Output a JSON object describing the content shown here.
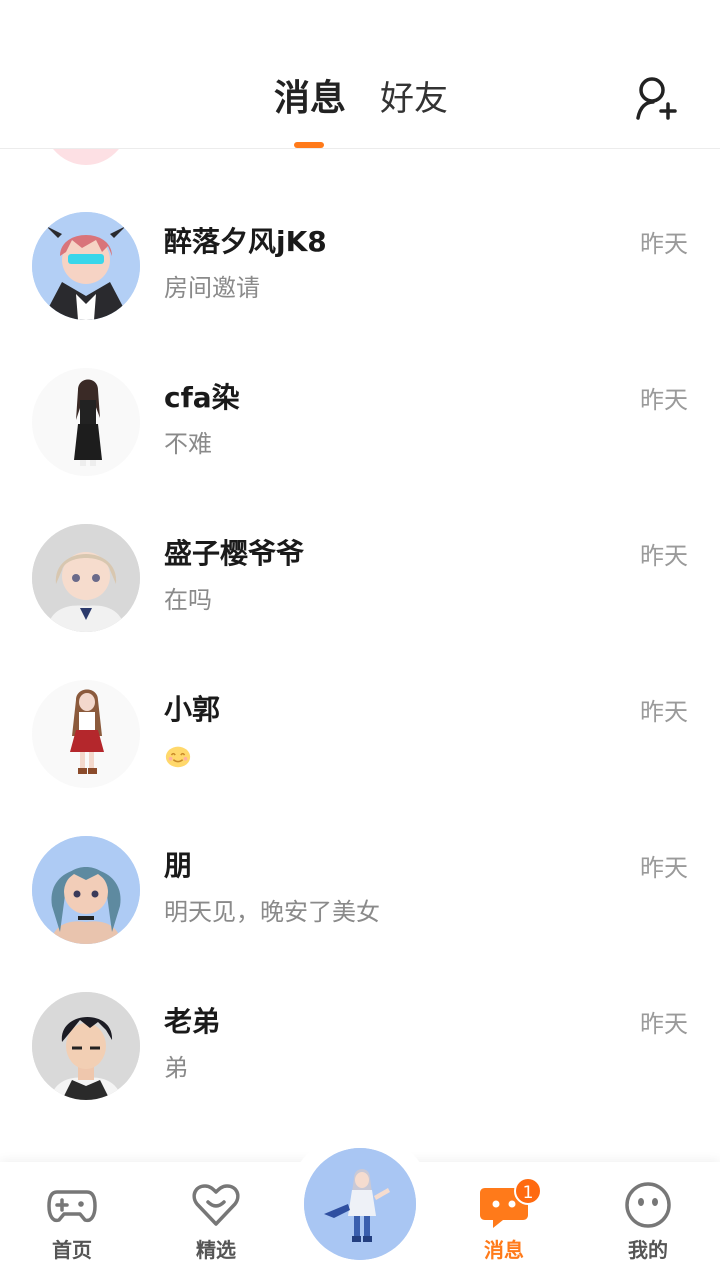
{
  "header": {
    "tabs": [
      {
        "label": "消息",
        "active": true
      },
      {
        "label": "好友",
        "active": false
      }
    ],
    "add_friend_icon": "add-user-icon",
    "accent": "#ff7a1a"
  },
  "conversations": [
    {
      "name": "醉落夕风jK8",
      "preview": "房间邀请",
      "time": "昨天"
    },
    {
      "name": "cfa染",
      "preview": "不难",
      "time": "昨天"
    },
    {
      "name": "盛子樱爷爷",
      "preview": "在吗",
      "time": "昨天"
    },
    {
      "name": "小郭",
      "preview": "",
      "preview_icon": "smile-emoji-icon",
      "time": "昨天"
    },
    {
      "name": "朋",
      "preview": "明天见，晚安了美女",
      "time": "昨天"
    },
    {
      "name": "老弟",
      "preview": "弟",
      "time": "昨天"
    }
  ],
  "nav": {
    "items": [
      {
        "label": "首页",
        "icon": "gamepad-icon"
      },
      {
        "label": "精选",
        "icon": "heart-icon"
      },
      {
        "label": "消息",
        "icon": "chat-bubble-icon",
        "active": true,
        "badge": "1"
      },
      {
        "label": "我的",
        "icon": "face-icon"
      }
    ]
  }
}
